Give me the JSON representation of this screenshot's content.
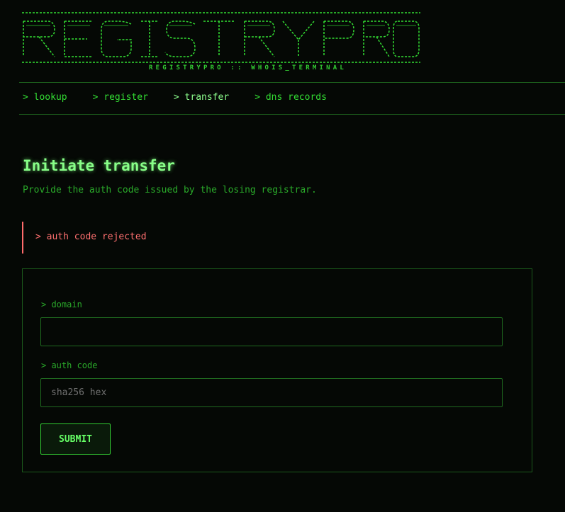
{
  "header": {
    "banner_logo": "REGISTRYPRO",
    "tagline": "REGISTRYPRO :: WHOIS_TERMINAL"
  },
  "nav": {
    "items": [
      {
        "label": "> lookup"
      },
      {
        "label": "> register"
      },
      {
        "label": "> transfer"
      },
      {
        "label": "> dns records"
      }
    ],
    "active": "> transfer"
  },
  "main": {
    "title": "Initiate transfer",
    "subtitle": "Provide the auth code issued by the losing registrar.",
    "alert": "> auth code rejected"
  },
  "form": {
    "domain_label": "> domain",
    "domain_value": "",
    "domain_placeholder": "",
    "auth_label": "> auth code",
    "auth_value": "",
    "auth_placeholder": "sha256 hex",
    "submit_label": "SUBMIT"
  },
  "colors": {
    "background": "#050805",
    "accent": "#33dd33",
    "highlight": "#88ff88",
    "error": "#ff6b6b",
    "border": "#1b5a1b"
  }
}
